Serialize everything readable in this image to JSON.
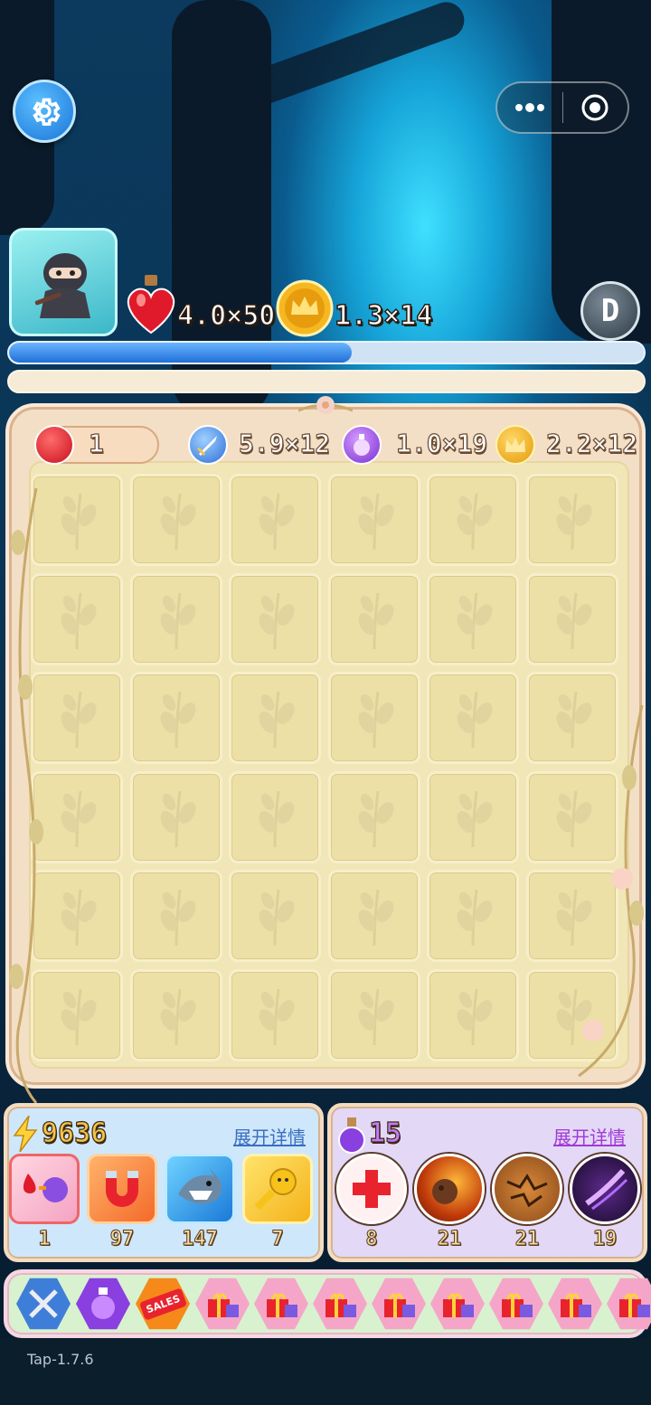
{
  "top": {
    "settings_icon": "gear-icon",
    "menu_icon": "more-dots-icon",
    "close_icon": "target-circle-icon"
  },
  "player": {
    "avatar": "ninja-avatar",
    "hearts": "4.0×50",
    "coins": "1.3×14",
    "badge": "D",
    "xp_progress": 0.54
  },
  "board": {
    "resources": [
      {
        "icon": "heart-icon",
        "value": "1"
      },
      {
        "icon": "sword-icon",
        "value": "5.9×12"
      },
      {
        "icon": "potion-icon",
        "value": "1.0×19"
      },
      {
        "icon": "coin-icon",
        "value": "2.2×12"
      }
    ],
    "rows": 6,
    "cols": 6
  },
  "energy_panel": {
    "count": "9636",
    "detail_label": "展开详情",
    "items": [
      {
        "icon": "blood-transform-icon",
        "count": "1"
      },
      {
        "icon": "magnet-icon",
        "count": "97"
      },
      {
        "icon": "shark-icon",
        "count": "147"
      },
      {
        "icon": "key-icon",
        "count": "7"
      }
    ]
  },
  "potion_panel": {
    "count": "15",
    "detail_label": "展开详情",
    "items": [
      {
        "icon": "heal-cross-icon",
        "count": "8"
      },
      {
        "icon": "meteor-icon",
        "count": "21"
      },
      {
        "icon": "ground-crack-icon",
        "count": "21"
      },
      {
        "icon": "purple-slash-icon",
        "count": "19"
      }
    ]
  },
  "shop": {
    "items": [
      "crossed-swords-icon",
      "potion-icon",
      "sales-tag-icon",
      "gift-icon",
      "gift-icon",
      "gift-icon",
      "gift-icon",
      "gift-icon",
      "gift-icon",
      "gift-icon",
      "gift-icon"
    ],
    "sales_label": "SALES"
  },
  "version": "Tap-1.7.6",
  "colors": {
    "accent_blue": "#1a74d8",
    "board_bg": "#f3dfc6",
    "cell": "#ede0a6",
    "energy_panel": "#cfe7fb",
    "potion_panel": "#e3d8f6"
  }
}
